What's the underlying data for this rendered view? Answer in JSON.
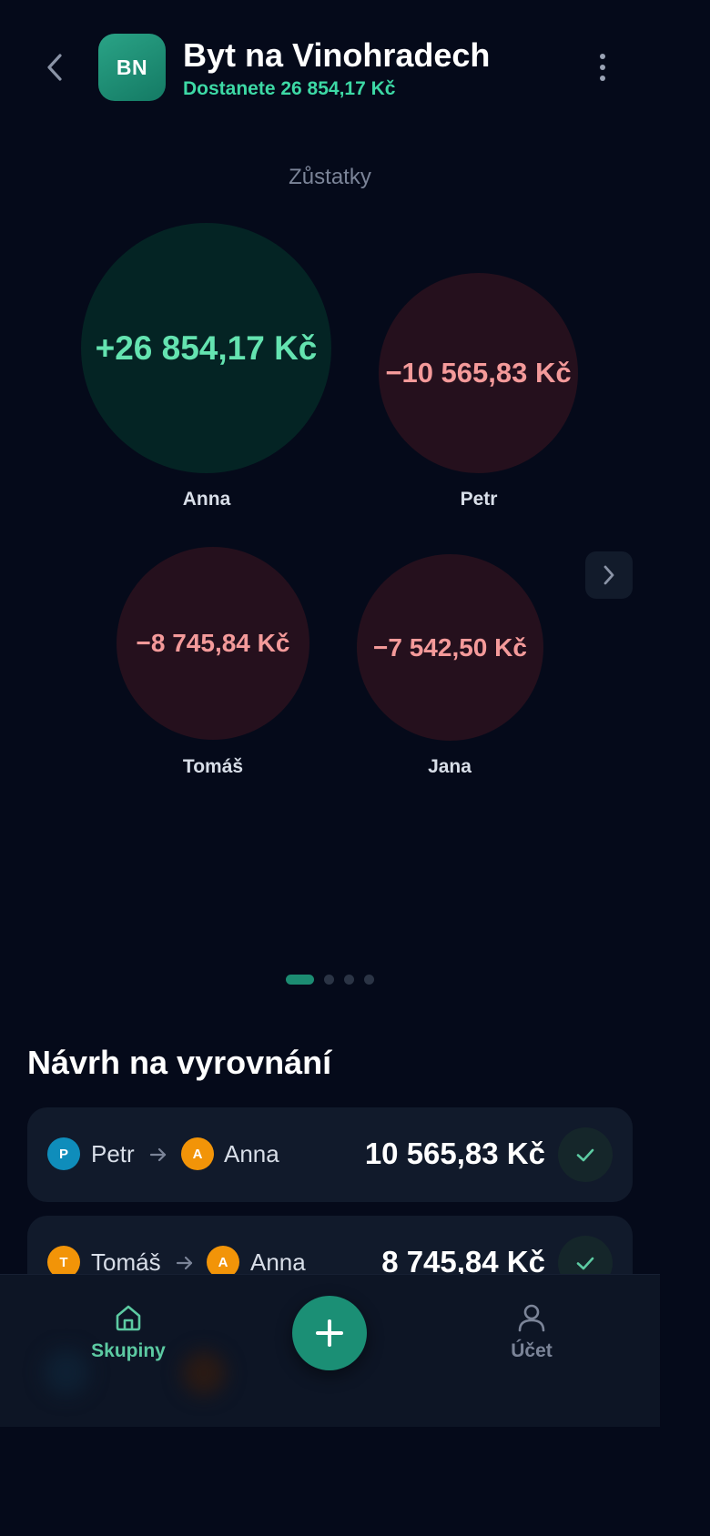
{
  "header": {
    "avatar_initials": "BN",
    "title": "Byt na Vinohradech",
    "subtitle": "Dostanete 26 854,17 Kč"
  },
  "balances": {
    "section_label": "Zůstatky",
    "people": [
      {
        "name": "Anna",
        "amount": "+26 854,17 Kč",
        "sign": "positive"
      },
      {
        "name": "Petr",
        "amount": "−10 565,83 Kč",
        "sign": "negative"
      },
      {
        "name": "Tomáš",
        "amount": "−8 745,84 Kč",
        "sign": "negative"
      },
      {
        "name": "Jana",
        "amount": "−7 542,50 Kč",
        "sign": "negative"
      }
    ],
    "pager": {
      "pages": 4,
      "current": 1
    }
  },
  "settlement": {
    "title": "Návrh na vyrovnání",
    "items": [
      {
        "from": "Petr",
        "from_initial": "P",
        "to": "Anna",
        "to_initial": "A",
        "amount": "10 565,83 Kč"
      },
      {
        "from": "Tomáš",
        "from_initial": "T",
        "to": "Anna",
        "to_initial": "A",
        "amount": "8 745,84 Kč"
      }
    ]
  },
  "nav": {
    "groups_label": "Skupiny",
    "account_label": "Účet"
  },
  "colors": {
    "background": "#050a1a",
    "accent": "#3dd9a5",
    "positive": "#64e3b0",
    "negative": "#f49a9a",
    "avatar_blue": "#0f8dbb",
    "avatar_orange": "#f29408"
  },
  "icons": [
    "back-icon",
    "more-vertical-icon",
    "chevron-right-icon",
    "arrow-right-icon",
    "check-icon",
    "home-icon",
    "plus-icon",
    "user-icon"
  ]
}
